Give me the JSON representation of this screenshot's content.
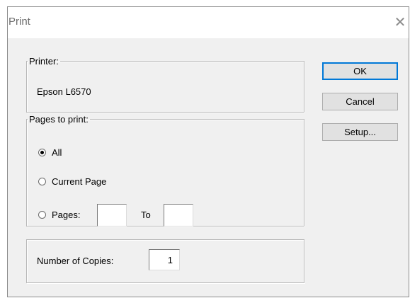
{
  "window": {
    "title": "Print",
    "close_glyph": "✕"
  },
  "printer": {
    "legend": "Printer:",
    "name": "Epson L6570"
  },
  "pages": {
    "legend": "Pages to print:",
    "options": [
      {
        "label": "All",
        "selected": true
      },
      {
        "label": "Current Page",
        "selected": false
      },
      {
        "label": "Pages:",
        "selected": false
      }
    ],
    "from_value": "",
    "to_label": "To",
    "to_value": ""
  },
  "copies": {
    "label": "Number of Copies:",
    "value": "1"
  },
  "buttons": {
    "ok": "OK",
    "cancel": "Cancel",
    "setup": "Setup..."
  },
  "icons": {
    "close": "close-icon",
    "radio_selected": "radio-selected-icon",
    "radio_unselected": "radio-unselected-icon"
  },
  "colors": {
    "dialog_background": "#f0f0f0",
    "titlebar_background": "#ffffff",
    "group_border": "#b8b8b8",
    "button_face": "#e1e1e1",
    "focus_accent": "#0078d7"
  }
}
